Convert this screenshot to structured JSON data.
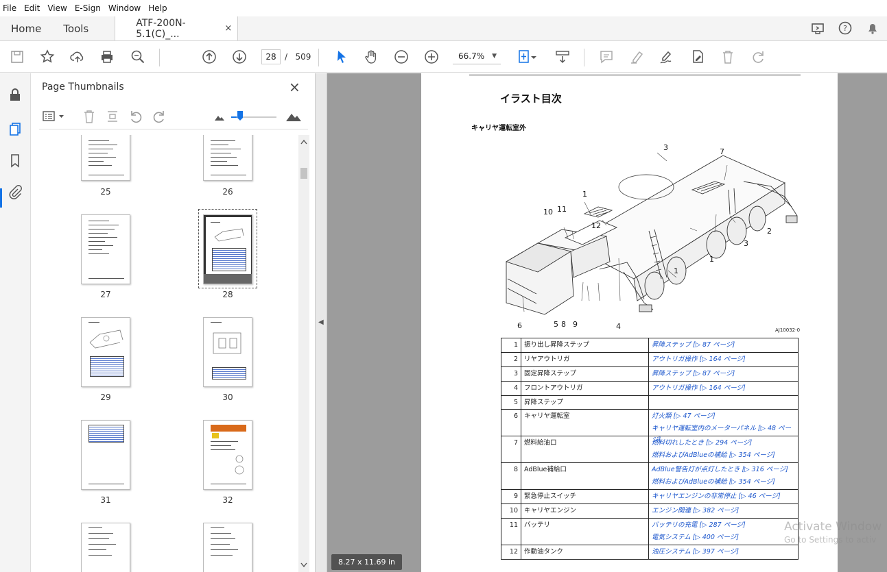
{
  "menu": [
    "File",
    "Edit",
    "View",
    "E-Sign",
    "Window",
    "Help"
  ],
  "tabs": {
    "home": "Home",
    "tools": "Tools",
    "doc": "ATF-200N-5.1(C)_...",
    "doc_close": "×"
  },
  "toolbar": {
    "page_current": "28",
    "page_sep": "/",
    "page_total": "509",
    "zoom": "66.7%"
  },
  "panel": {
    "title": "Page Thumbnails",
    "close": "×",
    "thumbs": [
      {
        "label": "25"
      },
      {
        "label": "26"
      },
      {
        "label": "27"
      },
      {
        "label": "28"
      },
      {
        "label": "29"
      },
      {
        "label": "30"
      },
      {
        "label": "31"
      },
      {
        "label": "32"
      }
    ]
  },
  "doc": {
    "title": "イラスト目次",
    "subtitle": "キャリヤ運転室外",
    "illustration_code": "AJ10032-0",
    "callouts": [
      "1",
      "1",
      "1",
      "2",
      "3",
      "3",
      "4",
      "5",
      "6",
      "7",
      "8",
      "9",
      "10",
      "11",
      "12"
    ],
    "rows": [
      {
        "num": "1",
        "name": "振り出し昇降ステップ",
        "links": [
          "昇降ステップ [▷ 87 ページ]"
        ]
      },
      {
        "num": "2",
        "name": "リヤアウトリガ",
        "links": [
          "アウトリガ操作 [▷ 164 ページ]"
        ]
      },
      {
        "num": "3",
        "name": "固定昇降ステップ",
        "links": [
          "昇降ステップ [▷ 87 ページ]"
        ]
      },
      {
        "num": "4",
        "name": "フロントアウトリガ",
        "links": [
          "アウトリガ操作 [▷ 164 ページ]"
        ]
      },
      {
        "num": "5",
        "name": "昇降ステップ",
        "links": []
      },
      {
        "num": "6",
        "name": "キャリヤ運転室",
        "links": [
          "灯火類 [▷ 47 ページ]",
          "キャリヤ運転室内のメーターパネル [▷ 48 ページ]"
        ]
      },
      {
        "num": "7",
        "name": "燃料給油口",
        "links": [
          "燃料切れしたとき [▷ 294 ページ]",
          "燃料およびAdBlueの補給 [▷ 354 ページ]"
        ]
      },
      {
        "num": "8",
        "name": "AdBlue補給口",
        "links": [
          "AdBlue警告灯が点灯したとき [▷ 316 ページ]",
          "燃料およびAdBlueの補給 [▷ 354 ページ]"
        ]
      },
      {
        "num": "9",
        "name": "緊急停止スイッチ",
        "links": [
          "キャリヤエンジンの非常停止 [▷ 46 ページ]"
        ]
      },
      {
        "num": "10",
        "name": "キャリヤエンジン",
        "links": [
          "エンジン関連 [▷ 382 ページ]"
        ]
      },
      {
        "num": "11",
        "name": "バッテリ",
        "links": [
          "バッテリの充電 [▷ 287 ページ]",
          "電気システム [▷ 400 ページ]"
        ]
      },
      {
        "num": "12",
        "name": "作動油タンク",
        "links": [
          "油圧システム [▷ 397 ページ]"
        ]
      }
    ]
  },
  "status": {
    "page_size": "8.27 x 11.69 in"
  },
  "watermark": {
    "line1": "Activate Window",
    "line2": "Go to Settings to activ"
  },
  "colors": {
    "accent": "#1473e6",
    "link": "#1a55cc",
    "viewer_bg": "#9c9c9c"
  }
}
